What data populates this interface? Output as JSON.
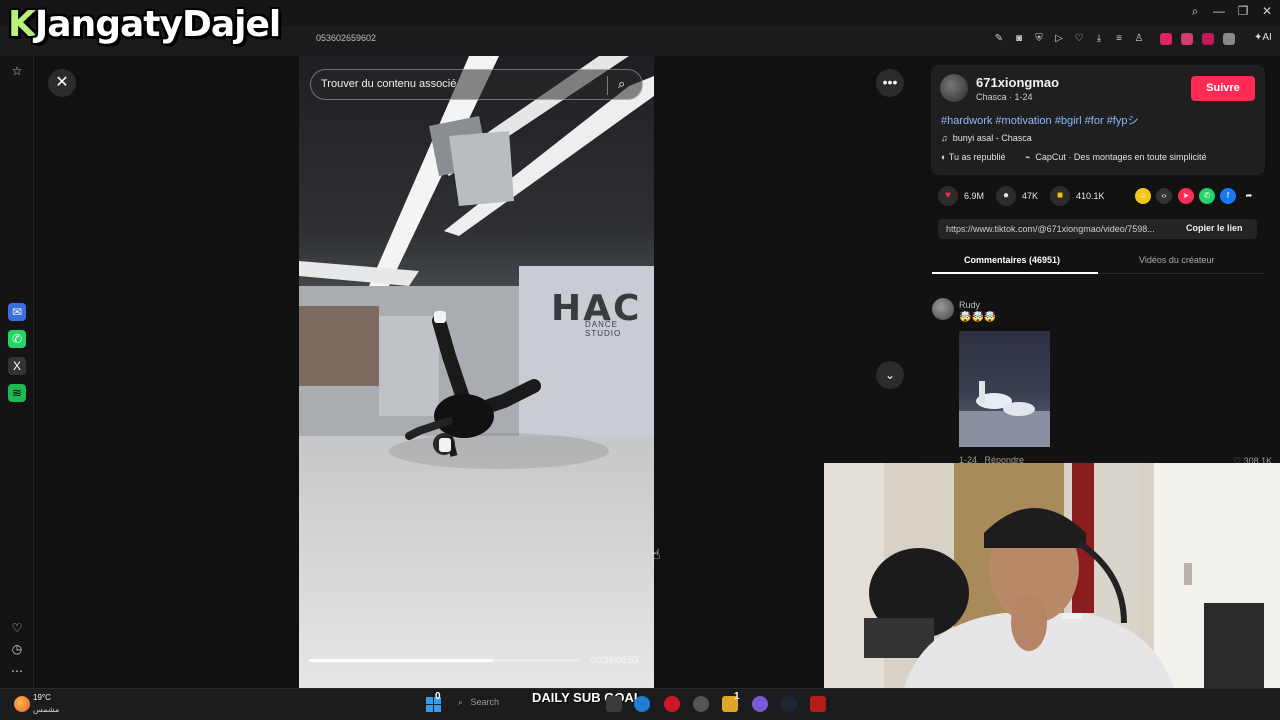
{
  "overlay": {
    "title": "KJangatyDajel"
  },
  "browser": {
    "url_fragment": "053602659602",
    "ai_label": "AI"
  },
  "video": {
    "search_placeholder": "Trouver du contenu associé",
    "studio_sign": "HAC",
    "studio_sub": "DANCE STUDIO",
    "time": "00:36/00:53",
    "progress": 0.68
  },
  "post": {
    "username": "671xiongmao",
    "subline": "Chasca · 1-24",
    "follow_label": "Suivre",
    "hashtags": "#hardwork #motivation #bgirl #for #fypシ",
    "music": "bunyi asal - Chasca",
    "repost": "Tu as republié",
    "capcut": "CapCut · Des montages en toute simplicité",
    "likes": "6.9M",
    "comments": "47K",
    "saves": "410.1K",
    "link": "https://www.tiktok.com/@671xiongmao/video/7598...",
    "copy_label": "Copier le lien"
  },
  "tabs": {
    "comments": "Commentaires (46951)",
    "creator_videos": "Vidéos du créateur"
  },
  "comment": {
    "author": "Rudy",
    "emoji": "🤯🤯🤯",
    "date": "1-24",
    "reply": "Répondre",
    "likes": "308.1K"
  },
  "taskbar": {
    "temp": "19°C",
    "weather": "مشمس",
    "search": "Search",
    "count1": "0",
    "count2": "1",
    "sub_goal": "DAILY SUB GOAL"
  },
  "colors": {
    "accent": "#fe2c55",
    "hashtag": "#8fb7ff"
  }
}
